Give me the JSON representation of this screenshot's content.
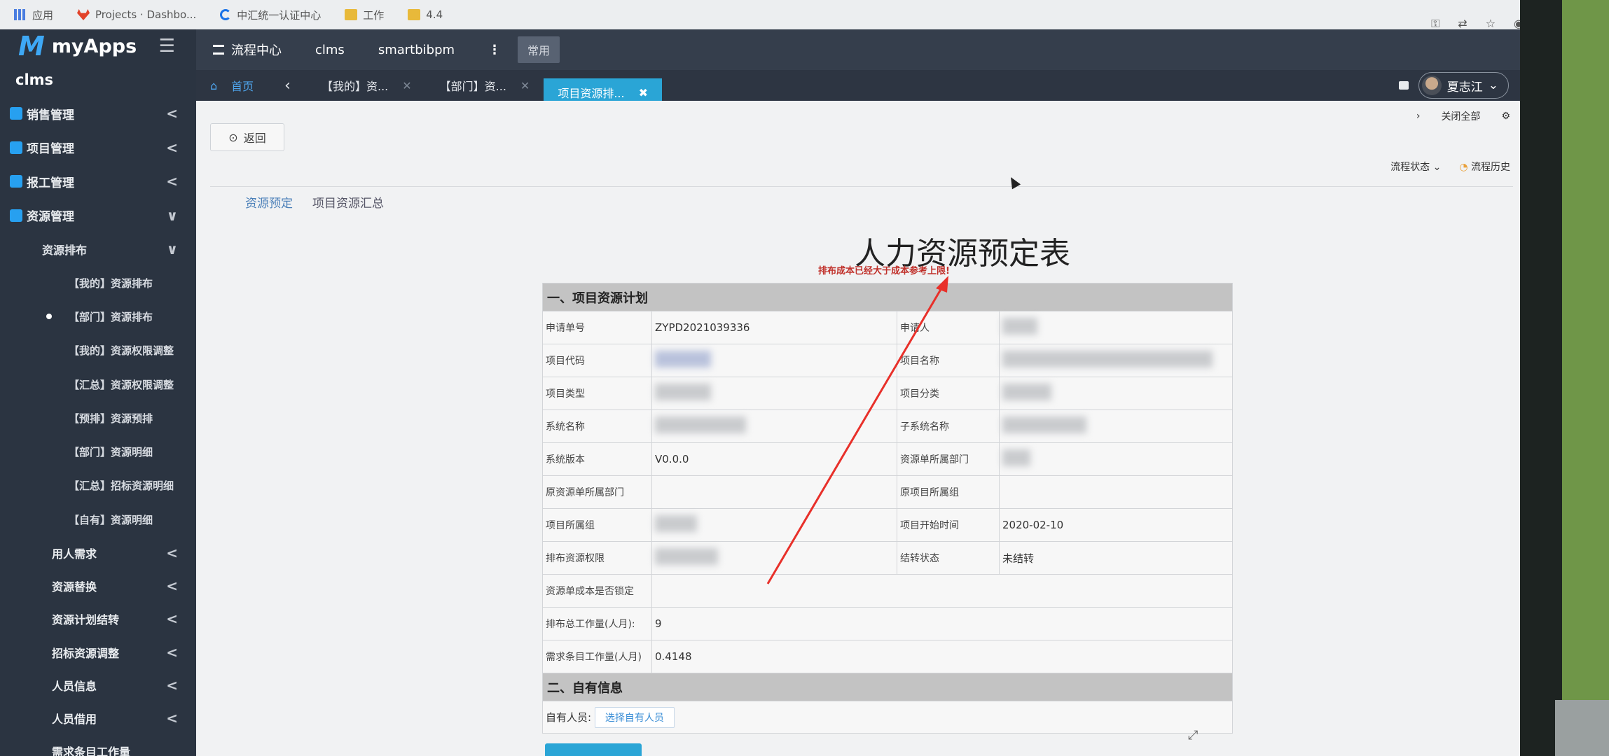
{
  "bookmarks": [
    {
      "icon": "apps-icon",
      "label": "应用"
    },
    {
      "icon": "gitlab-icon",
      "label": "Projects · Dashbo..."
    },
    {
      "icon": "google-icon",
      "label": "中汇统一认证中心"
    },
    {
      "icon": "folder-icon",
      "label": "工作"
    },
    {
      "icon": "folder-icon",
      "label": "4.4"
    }
  ],
  "brand": {
    "logo": "M",
    "name": "myApps"
  },
  "sidebar": {
    "system": "clms",
    "menus": [
      {
        "label": "销售管理",
        "chevron": "<"
      },
      {
        "label": "项目管理",
        "chevron": "<"
      },
      {
        "label": "报工管理",
        "chevron": "<"
      },
      {
        "label": "资源管理",
        "chevron": "∨"
      }
    ],
    "submenu": {
      "label": "资源排布",
      "chevron": "∨"
    },
    "subitems": [
      "【我的】资源排布",
      "【部门】资源排布",
      "【我的】资源权限调整",
      "【汇总】资源权限调整",
      "【预排】资源预排",
      "【部门】资源明细",
      "【汇总】招标资源明细",
      "【自有】资源明细"
    ],
    "active_subitem": "【部门】资源排布",
    "lower": [
      "用人需求",
      "资源替换",
      "资源计划结转",
      "招标资源调整",
      "人员信息",
      "人员借用",
      "需求条目工作量"
    ]
  },
  "topnav": {
    "items": [
      "流程中心",
      "clms",
      "smartbibpm"
    ],
    "more": "⋮",
    "common": "常用"
  },
  "tabs": {
    "home": "首页",
    "list": [
      {
        "label": "【我的】资...",
        "active": false
      },
      {
        "label": "【部门】资...",
        "active": false
      },
      {
        "label": "项目资源排...",
        "active": true
      }
    ],
    "user": "夏志江"
  },
  "toolbar": {
    "close_all": "关闭全部"
  },
  "back": "返回",
  "flow": {
    "status": "流程状态",
    "history": "流程历史"
  },
  "subtabs": [
    "资源预定",
    "项目资源汇总"
  ],
  "form": {
    "title": "人力资源预定表",
    "warning": "排布成本已经大于成本参考上限!",
    "section1": "一、项目资源计划",
    "section2": "二、自有信息",
    "labels": {
      "apply_no": "申请单号",
      "applicant": "申请人",
      "project_code": "项目代码",
      "project_name": "项目名称",
      "project_type": "项目类型",
      "project_category": "项目分类",
      "system_name": "系统名称",
      "subsystem_name": "子系统名称",
      "system_version": "系统版本",
      "resource_dept": "资源单所属部门",
      "orig_resource_dept": "原资源单所属部门",
      "orig_project_group": "原项目所属组",
      "project_group": "项目所属组",
      "project_start": "项目开始时间",
      "arrange_permission": "排布资源权限",
      "carry_status": "结转状态",
      "cost_locked": "资源单成本是否锁定",
      "total_workload": "排布总工作量(人月):",
      "req_workload": "需求条目工作量(人月)"
    },
    "values": {
      "apply_no": "ZYPD2021039336",
      "system_version": "V0.0.0",
      "project_start": "2020-02-10",
      "carry_status": "未结转",
      "total_workload": "9",
      "req_workload": "0.4148"
    },
    "own_label": "自有人员:",
    "pick_button": "选择自有人员"
  }
}
